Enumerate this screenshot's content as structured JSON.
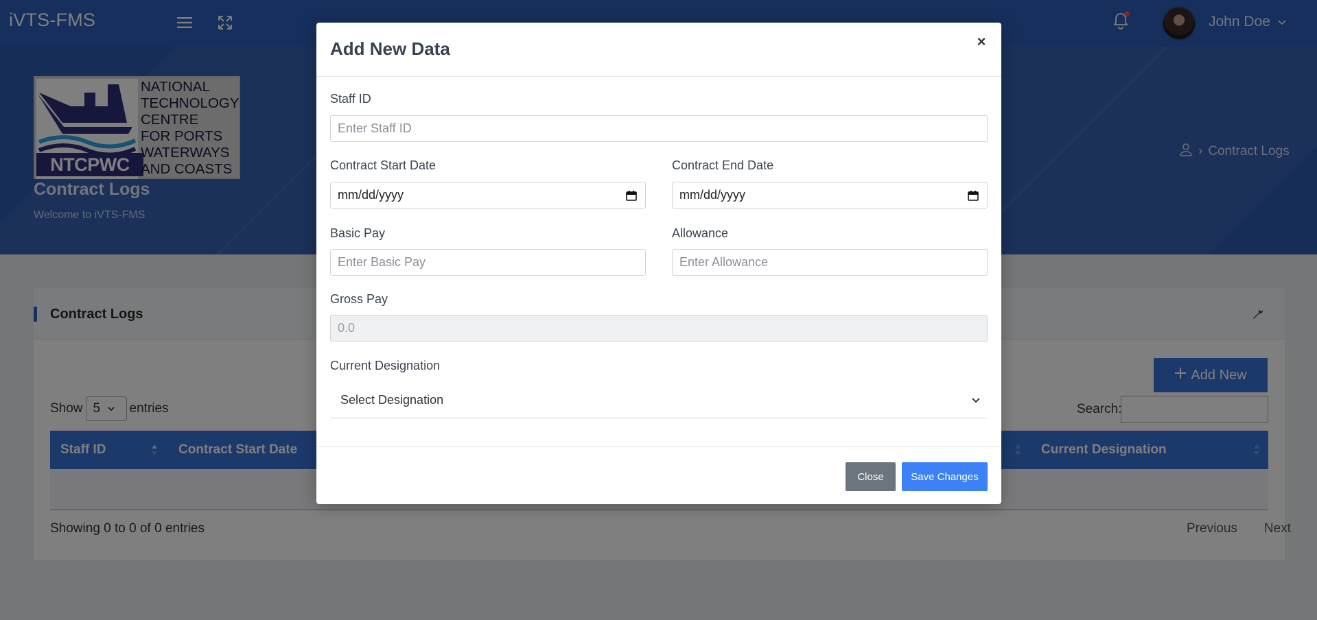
{
  "app": {
    "brand": "iVTS-FMS"
  },
  "user": {
    "name": "John Doe"
  },
  "banner": {
    "logo_abbr": "NTCPWC",
    "logo_text": [
      "NATIONAL",
      "TECHNOLOGY",
      "CENTRE",
      "FOR PORTS",
      "WATERWAYS",
      "AND COASTS"
    ],
    "page_title": "Contract Logs",
    "page_subtitle": "Welcome to iVTS-FMS",
    "breadcrumb": "Contract Logs"
  },
  "card": {
    "title": "Contract Logs",
    "add_button": "Add New",
    "show_label": "Show",
    "entries_label": "entries",
    "page_length": "5",
    "search_label": "Search:",
    "columns": [
      "Staff ID",
      "Contract Start Date",
      "Current Designation"
    ],
    "info": "Showing 0 to 0 of 0 entries",
    "prev": "Previous",
    "next": "Next"
  },
  "modal": {
    "title": "Add New Data",
    "close_symbol": "×",
    "fields": {
      "staff_id": {
        "label": "Staff ID",
        "placeholder": "Enter Staff ID"
      },
      "start_date": {
        "label": "Contract Start Date",
        "value": "mm/dd/yyyy"
      },
      "end_date": {
        "label": "Contract End Date",
        "value": "mm/dd/yyyy"
      },
      "basic_pay": {
        "label": "Basic Pay",
        "placeholder": "Enter Basic Pay"
      },
      "allowance": {
        "label": "Allowance",
        "placeholder": "Enter Allowance"
      },
      "gross_pay": {
        "label": "Gross Pay",
        "value": "0.0"
      },
      "designation": {
        "label": "Current Designation",
        "selected": "Select Designation"
      }
    },
    "close_button": "Close",
    "save_button": "Save Changes"
  }
}
